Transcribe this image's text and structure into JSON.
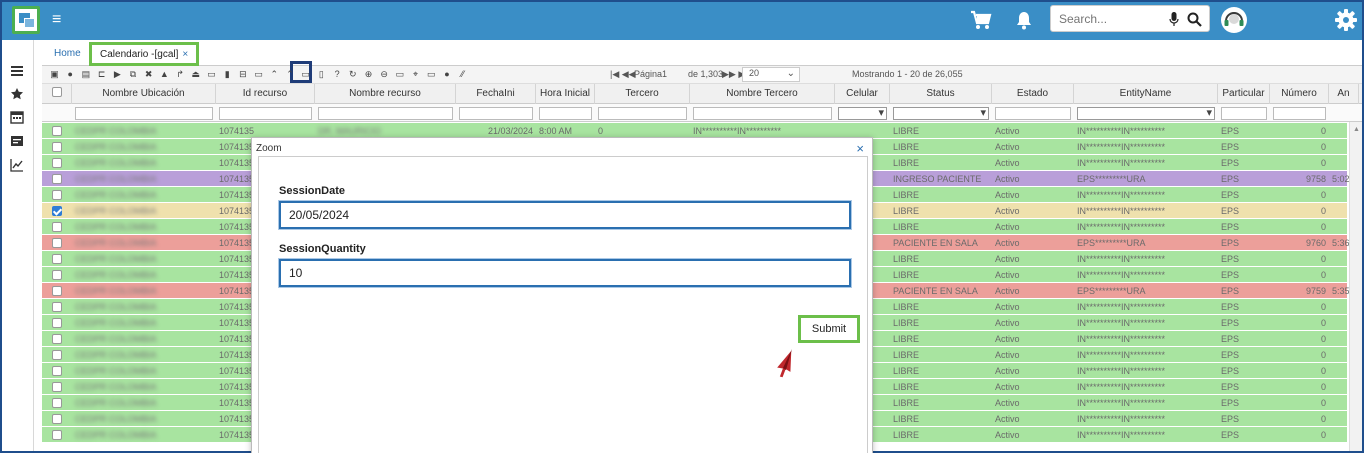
{
  "topbar": {
    "search_placeholder": "Search..."
  },
  "tabs": {
    "home": "Home",
    "calendar": "Calendario -[gcal]",
    "calendar_close": "×"
  },
  "pager": {
    "first_prev": "|◀ ◀◀",
    "page_label": "Página",
    "page_value": "1",
    "of_label": "de 1,303",
    "next_last": "▶▶ ▶|",
    "rows_per_page": "20",
    "showing": "Mostrando 1 - 20 de 26,055"
  },
  "grid": {
    "columns": [
      "Nombre Ubicación",
      "Id recurso",
      "Nombre recurso",
      "FechaIni",
      "Hora Inicial",
      "Tercero",
      "Nombre Tercero",
      "Celular",
      "Status",
      "Estado",
      "EntityName",
      "Particular",
      "Número",
      "An"
    ],
    "rows": [
      {
        "loc": "CEDPR COLOMBIA",
        "id": "1074135",
        "res": "DR. MAURICIO",
        "fecha": "21/03/2024",
        "hora": "8:00 AM",
        "tercero": "0",
        "ntercero": "IN**********IN**********",
        "status": "LIBRE",
        "estado": "Activo",
        "entity": "IN**********IN**********",
        "part": "EPS",
        "num": "0",
        "an": "",
        "color": "green",
        "checked": false
      },
      {
        "loc": "CEDPR COLOMBIA",
        "id": "1074135",
        "res": "",
        "fecha": "",
        "hora": "",
        "tercero": "",
        "ntercero": "",
        "status": "LIBRE",
        "estado": "Activo",
        "entity": "IN**********IN**********",
        "part": "EPS",
        "num": "0",
        "an": "",
        "color": "green",
        "checked": false
      },
      {
        "loc": "CEDPR COLOMBIA",
        "id": "1074135",
        "res": "",
        "fecha": "",
        "hora": "",
        "tercero": "",
        "ntercero": "",
        "status": "LIBRE",
        "estado": "Activo",
        "entity": "IN**********IN**********",
        "part": "EPS",
        "num": "0",
        "an": "",
        "color": "green",
        "checked": false
      },
      {
        "loc": "CEDPR COLOMBIA",
        "id": "1074135",
        "res": "",
        "fecha": "",
        "hora": "",
        "tercero": "",
        "ntercero": "",
        "status": "INGRESO PACIENTE",
        "estado": "Activo",
        "entity": "EPS*********URA",
        "part": "EPS",
        "num": "9758",
        "an": "5:02",
        "color": "purple",
        "checked": false
      },
      {
        "loc": "CEDPR COLOMBIA",
        "id": "1074135",
        "res": "",
        "fecha": "",
        "hora": "",
        "tercero": "",
        "ntercero": "",
        "status": "LIBRE",
        "estado": "Activo",
        "entity": "IN**********IN**********",
        "part": "EPS",
        "num": "0",
        "an": "",
        "color": "green",
        "checked": false
      },
      {
        "loc": "CEDPR COLOMBIA",
        "id": "1074135",
        "res": "",
        "fecha": "",
        "hora": "",
        "tercero": "",
        "ntercero": "",
        "status": "LIBRE",
        "estado": "Activo",
        "entity": "IN**********IN**********",
        "part": "EPS",
        "num": "0",
        "an": "",
        "color": "yellow",
        "checked": true
      },
      {
        "loc": "CEDPR COLOMBIA",
        "id": "1074135",
        "res": "",
        "fecha": "",
        "hora": "",
        "tercero": "",
        "ntercero": "",
        "status": "LIBRE",
        "estado": "Activo",
        "entity": "IN**********IN**********",
        "part": "EPS",
        "num": "0",
        "an": "",
        "color": "green",
        "checked": false
      },
      {
        "loc": "CEDPR COLOMBIA",
        "id": "1074135",
        "res": "",
        "fecha": "",
        "hora": "",
        "tercero": "",
        "ntercero": "",
        "status": "PACIENTE EN SALA",
        "estado": "Activo",
        "entity": "EPS*********URA",
        "part": "EPS",
        "num": "9760",
        "an": "5:36",
        "color": "red",
        "checked": false
      },
      {
        "loc": "CEDPR COLOMBIA",
        "id": "1074135",
        "res": "",
        "fecha": "",
        "hora": "",
        "tercero": "",
        "ntercero": "",
        "status": "LIBRE",
        "estado": "Activo",
        "entity": "IN**********IN**********",
        "part": "EPS",
        "num": "0",
        "an": "",
        "color": "green",
        "checked": false
      },
      {
        "loc": "CEDPR COLOMBIA",
        "id": "1074135",
        "res": "",
        "fecha": "",
        "hora": "",
        "tercero": "",
        "ntercero": "",
        "status": "LIBRE",
        "estado": "Activo",
        "entity": "IN**********IN**********",
        "part": "EPS",
        "num": "0",
        "an": "",
        "color": "green",
        "checked": false
      },
      {
        "loc": "CEDPR COLOMBIA",
        "id": "1074135",
        "res": "",
        "fecha": "",
        "hora": "",
        "tercero": "",
        "ntercero": "",
        "status": "PACIENTE EN SALA",
        "estado": "Activo",
        "entity": "EPS*********URA",
        "part": "EPS",
        "num": "9759",
        "an": "5:35",
        "color": "red",
        "checked": false
      },
      {
        "loc": "CEDPR COLOMBIA",
        "id": "1074135",
        "res": "",
        "fecha": "",
        "hora": "",
        "tercero": "",
        "ntercero": "",
        "status": "LIBRE",
        "estado": "Activo",
        "entity": "IN**********IN**********",
        "part": "EPS",
        "num": "0",
        "an": "",
        "color": "green",
        "checked": false
      },
      {
        "loc": "CEDPR COLOMBIA",
        "id": "1074135",
        "res": "",
        "fecha": "",
        "hora": "",
        "tercero": "",
        "ntercero": "",
        "status": "LIBRE",
        "estado": "Activo",
        "entity": "IN**********IN**********",
        "part": "EPS",
        "num": "0",
        "an": "",
        "color": "green",
        "checked": false
      },
      {
        "loc": "CEDPR COLOMBIA",
        "id": "1074135",
        "res": "",
        "fecha": "",
        "hora": "",
        "tercero": "",
        "ntercero": "",
        "status": "LIBRE",
        "estado": "Activo",
        "entity": "IN**********IN**********",
        "part": "EPS",
        "num": "0",
        "an": "",
        "color": "green",
        "checked": false
      },
      {
        "loc": "CEDPR COLOMBIA",
        "id": "1074135",
        "res": "",
        "fecha": "",
        "hora": "",
        "tercero": "",
        "ntercero": "",
        "status": "LIBRE",
        "estado": "Activo",
        "entity": "IN**********IN**********",
        "part": "EPS",
        "num": "0",
        "an": "",
        "color": "green",
        "checked": false
      },
      {
        "loc": "CEDPR COLOMBIA",
        "id": "1074135",
        "res": "",
        "fecha": "",
        "hora": "",
        "tercero": "",
        "ntercero": "",
        "status": "LIBRE",
        "estado": "Activo",
        "entity": "IN**********IN**********",
        "part": "EPS",
        "num": "0",
        "an": "",
        "color": "green",
        "checked": false
      },
      {
        "loc": "CEDPR COLOMBIA",
        "id": "1074135",
        "res": "",
        "fecha": "",
        "hora": "",
        "tercero": "",
        "ntercero": "",
        "status": "LIBRE",
        "estado": "Activo",
        "entity": "IN**********IN**********",
        "part": "EPS",
        "num": "0",
        "an": "",
        "color": "green",
        "checked": false
      },
      {
        "loc": "CEDPR COLOMBIA",
        "id": "1074135",
        "res": "",
        "fecha": "",
        "hora": "",
        "tercero": "",
        "ntercero": "",
        "status": "LIBRE",
        "estado": "Activo",
        "entity": "IN**********IN**********",
        "part": "EPS",
        "num": "0",
        "an": "",
        "color": "green",
        "checked": false
      },
      {
        "loc": "CEDPR COLOMBIA",
        "id": "1074135",
        "res": "",
        "fecha": "",
        "hora": "",
        "tercero": "",
        "ntercero": "",
        "status": "LIBRE",
        "estado": "Activo",
        "entity": "IN**********IN**********",
        "part": "EPS",
        "num": "0",
        "an": "",
        "color": "green",
        "checked": false
      },
      {
        "loc": "CEDPR COLOMBIA",
        "id": "1074135",
        "res": "",
        "fecha": "",
        "hora": "",
        "tercero": "",
        "ntercero": "",
        "status": "LIBRE",
        "estado": "Activo",
        "entity": "IN**********IN**********",
        "part": "EPS",
        "num": "0",
        "an": "",
        "color": "green",
        "checked": false
      }
    ]
  },
  "row_colors": {
    "green": "#a8e4a0",
    "purple": "#b99fd9",
    "yellow": "#efe1ad",
    "red": "#ec9f9a"
  },
  "modal": {
    "title": "Zoom",
    "close": "×",
    "session_date_label": "SessionDate",
    "session_date_value": "20/05/2024",
    "session_quantity_label": "SessionQuantity",
    "session_quantity_value": "10",
    "submit_label": "Submit"
  },
  "accent": {
    "topbar": "#3a8ec6",
    "highlight_green": "#6cbf4a",
    "highlight_navy": "#1f3c78"
  }
}
